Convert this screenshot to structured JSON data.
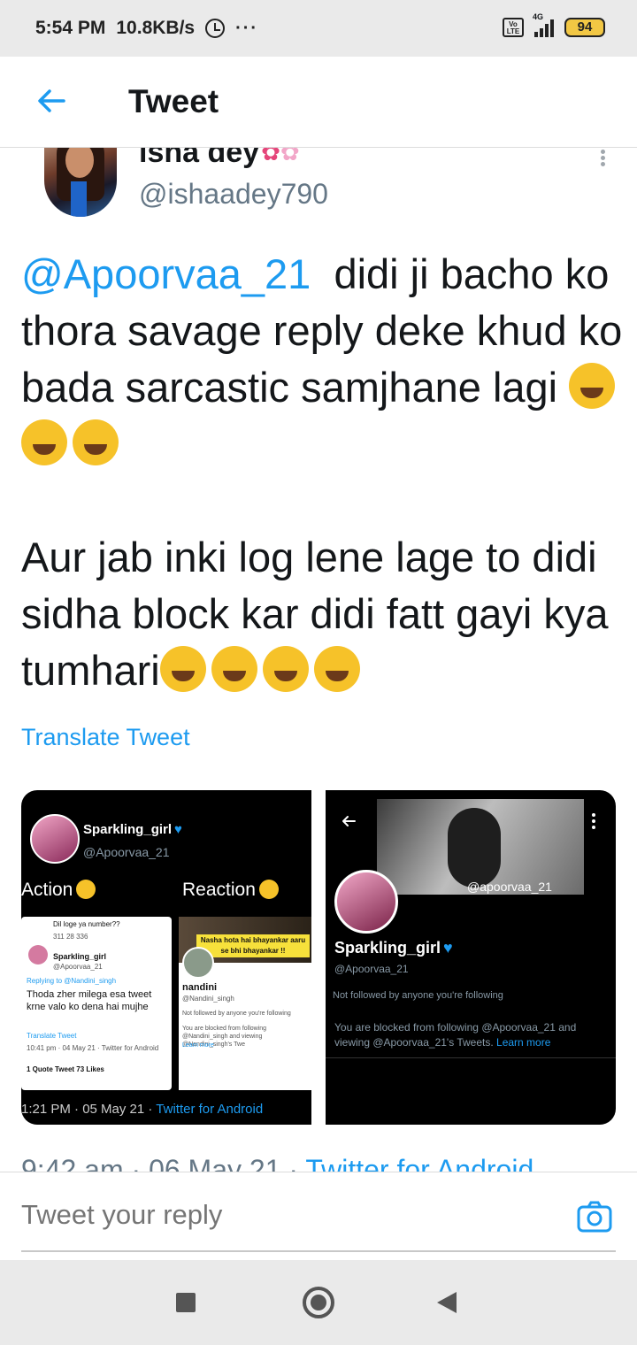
{
  "status_bar": {
    "time": "5:54 PM",
    "speed": "10.8KB/s",
    "dots": "···",
    "volte": "Vo LTE",
    "network": "4G",
    "battery": "94"
  },
  "header": {
    "title": "Tweet"
  },
  "author": {
    "name": "isha dey",
    "handle": "@ishaadey790"
  },
  "tweet": {
    "mention": "@Apoorvaa_21",
    "line1_rest": "  didi ji bacho ko thora savage reply deke khud ko bada sarcastic samjhane lagi ",
    "para2": "Aur jab inki log lene lage to didi sidha block kar didi fatt gayi kya tumhari",
    "translate": "Translate Tweet"
  },
  "media_left": {
    "name": "Sparkling_girl",
    "handle": "@Apoorvaa_21",
    "action": "Action",
    "reaction": "Reaction",
    "card_a": {
      "top_text": "Dil loge ya number??",
      "top_stats": "311   28   336",
      "name": "Sparkling_girl",
      "handle": "@Apoorvaa_21",
      "replying": "Replying to @Nandini_singh",
      "body": "Thoda zher milega esa tweet krne valo ko dena hai mujhe",
      "translate": "Translate Tweet",
      "meta": "10:41 pm · 04 May 21 · Twitter for Android",
      "stats": "1 Quote Tweet   73 Likes"
    },
    "card_b": {
      "banner": "Nasha hota hai bhayankar aaru se bhi bhayankar !!",
      "name": "nandini",
      "handle": "@Nandini_singh",
      "follow": "Not followed by anyone you're following",
      "blocked": "You are blocked from following @Nandini_singh and viewing @Nandini_singh's Twe",
      "learn": "Learn more"
    },
    "footer_time": "1:21 PM · 05 May 21 · ",
    "footer_app": "Twitter for Android"
  },
  "media_right": {
    "cover_handle": "@apoorvaa_21",
    "name": "Sparkling_girl",
    "handle": "@Apoorvaa_21",
    "follow": "Not followed by anyone you're following",
    "blocked": "You are blocked from following @Apoorvaa_21 and viewing @Apoorvaa_21's Tweets. ",
    "learn": "Learn more"
  },
  "timestamp": {
    "time": "9:42 am · 06 May 21 · ",
    "app": "Twitter for Android"
  },
  "reply": {
    "placeholder": "Tweet your reply"
  },
  "icons": {
    "back": "arrow-left",
    "more": "vertical-dots",
    "camera": "camera",
    "heart": "blue-heart"
  },
  "colors": {
    "accent": "#1d9bf0",
    "text": "#14171a",
    "secondary": "#657786"
  }
}
